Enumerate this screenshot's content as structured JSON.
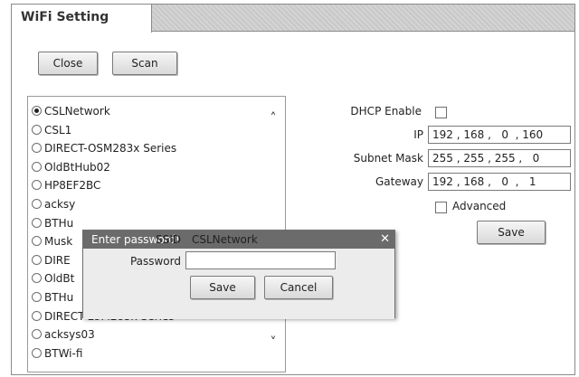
{
  "tab": {
    "title": "WiFi Setting"
  },
  "toolbar": {
    "close_label": "Close",
    "scan_label": "Scan"
  },
  "networks": [
    {
      "name": "CSLNetwork",
      "selected": true
    },
    {
      "name": "CSL1",
      "selected": false
    },
    {
      "name": "DIRECT-OSM283x Series",
      "selected": false
    },
    {
      "name": "OldBtHub02",
      "selected": false
    },
    {
      "name": "HP8EF2BC",
      "selected": false
    },
    {
      "name": "acksy",
      "selected": false
    },
    {
      "name": "BTHu",
      "selected": false
    },
    {
      "name": "Musk",
      "selected": false
    },
    {
      "name": "DIRE",
      "selected": false
    },
    {
      "name": "OldBt",
      "selected": false
    },
    {
      "name": "BTHu",
      "selected": false
    },
    {
      "name": "DIRECT-LUM283x Series",
      "selected": false
    },
    {
      "name": "acksys03",
      "selected": false
    },
    {
      "name": "BTWi-fi",
      "selected": false
    }
  ],
  "scroll": {
    "up_icon": "chevron-up-icon",
    "down_icon": "chevron-down-icon"
  },
  "settings": {
    "dhcp_label": "DHCP Enable",
    "dhcp_checked": false,
    "ip_label": "IP",
    "ip_value": "192 , 168 ,   0  , 160",
    "mask_label": "Subnet Mask",
    "mask_value": "255 , 255 , 255 ,   0",
    "gateway_label": "Gateway",
    "gateway_value": "192 , 168 ,   0  ,   1",
    "advanced_label": "Advanced",
    "advanced_checked": false,
    "save_label": "Save"
  },
  "dialog": {
    "title": "Enter password!",
    "close_icon": "close-icon",
    "ssid_label": "SSID",
    "ssid_value": "CSLNetwork",
    "password_label": "Password",
    "password_value": "",
    "save_label": "Save",
    "cancel_label": "Cancel"
  }
}
